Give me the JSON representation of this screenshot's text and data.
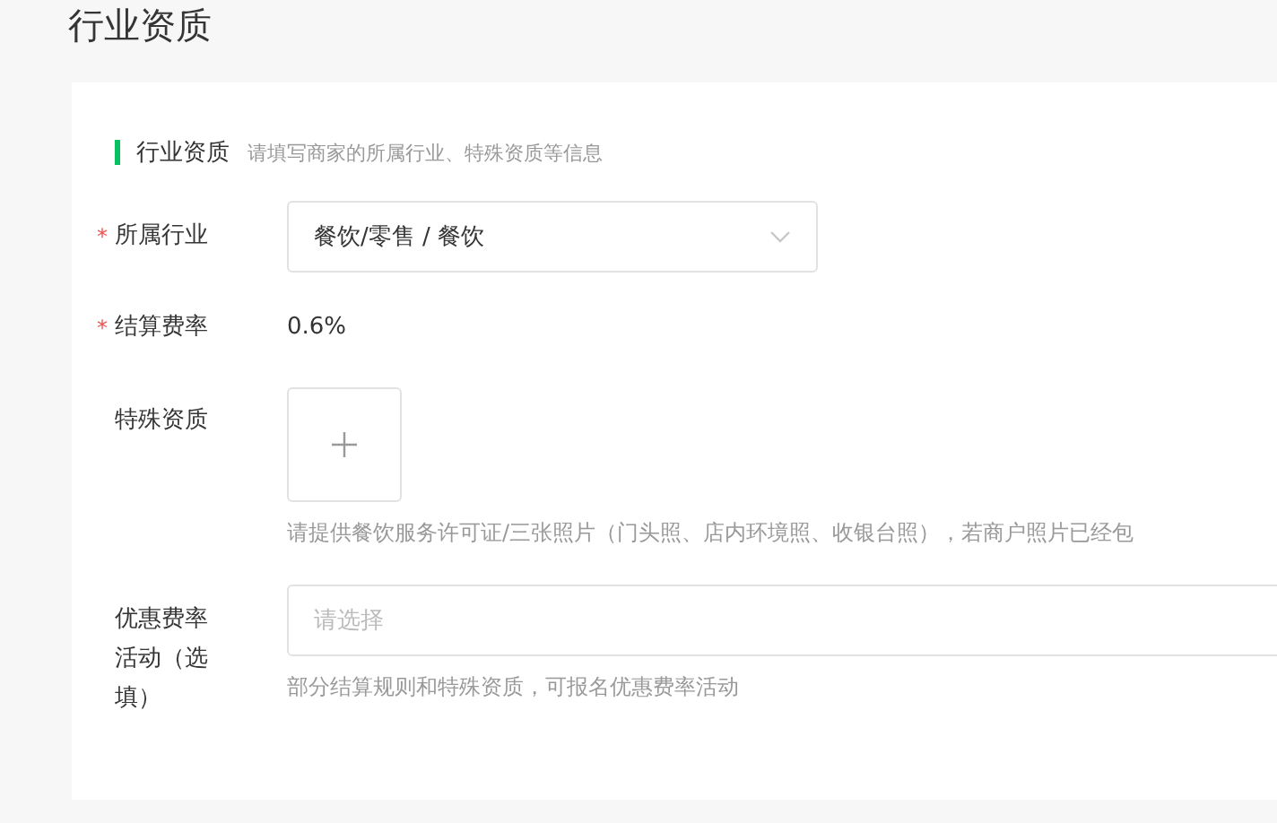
{
  "page_title": "行业资质",
  "required_mark": "*",
  "section": {
    "title": "行业资质",
    "description": "请填写商家的所属行业、特殊资质等信息"
  },
  "fields": [
    {
      "kind": "select",
      "label": "所属行业",
      "required": true,
      "value": "餐饮/零售 / 餐饮"
    },
    {
      "kind": "text",
      "label": "结算费率",
      "required": true,
      "value": "0.6%"
    },
    {
      "kind": "upload",
      "label": "特殊资质",
      "required": false,
      "hint": "请提供餐饮服务许可证/三张照片（门头照、店内环境照、收银台照），若商户照片已经包"
    },
    {
      "kind": "select",
      "label": "优惠费率活动（选填）",
      "required": false,
      "placeholder": "请选择",
      "hint": "部分结算规则和特殊资质，可报名优惠费率活动"
    }
  ]
}
